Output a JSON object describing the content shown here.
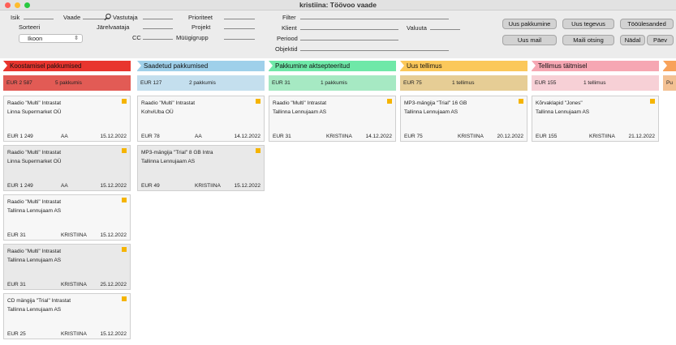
{
  "window": {
    "title": "kristiina: Töövoo vaade"
  },
  "form": {
    "labels": {
      "isik": "Isik",
      "vaade": "Vaade",
      "vastutaja": "Vastutaja",
      "prioriteet": "Prioriteet",
      "sorteeri": "Sorteeri",
      "jarelvaataja": "Järelvaataja",
      "projekt": "Projekt",
      "cc": "CC",
      "muugigrupp": "Müügigrupp",
      "filter": "Filter",
      "klient": "Klient",
      "valuuta": "Valuuta",
      "periood": "Periood",
      "objektid": "Objektid"
    },
    "sort_value": "Ikoon"
  },
  "buttons": {
    "uus_pakkumine": "Uus pakkumine",
    "uus_tegevus": "Uus tegevus",
    "tooulesanded": "Tööülesanded",
    "uus_mail": "Uus mail",
    "maili_otsing": "Maili otsing",
    "nadal": "Nädal",
    "paev": "Päev"
  },
  "columns": [
    {
      "title": "Koostamisel pakkumised",
      "color": "#e8352e",
      "sum_color": "#e25b55",
      "sum": "EUR 2 587",
      "count": "5 pakkumis",
      "cards": [
        {
          "l1": "Raadio \"Multi\" Intrastat",
          "l2": "Linna Supermarket OÜ",
          "amount": "EUR 1 249",
          "user": "AA",
          "date": "15.12.2022"
        },
        {
          "l1": "Raadio \"Multi\" Intrastat",
          "l2": "Linna Supermarket OÜ",
          "amount": "EUR 1 249",
          "user": "AA",
          "date": "15.12.2022"
        },
        {
          "l1": "Raadio \"Multi\" Intrastat",
          "l2": "Tallinna Lennujaam AS",
          "amount": "EUR 31",
          "user": "KRISTIINA",
          "date": "15.12.2022"
        },
        {
          "l1": "Raadio \"Multi\" Intrastat",
          "l2": "Tallinna Lennujaam AS",
          "amount": "EUR 31",
          "user": "KRISTIINA",
          "date": "25.12.2022"
        },
        {
          "l1": "CD mängija \"Trial\" Intrastat",
          "l2": "Tallinna Lennujaam AS",
          "amount": "EUR 25",
          "user": "KRISTIINA",
          "date": "15.12.2022"
        }
      ]
    },
    {
      "title": "Saadetud pakkumised",
      "color": "#9fd0ea",
      "sum_color": "#c4dfee",
      "sum": "EUR 127",
      "count": "2 pakkumis",
      "cards": [
        {
          "l1": "Raadio \"Multi\" Intrastat",
          "l2": "KohviUba OÜ",
          "amount": "EUR 78",
          "user": "AA",
          "date": "14.12.2022"
        },
        {
          "l1": "MP3-mängija \"Trial\" 8 GB Intra",
          "l2": "Tallinna Lennujaam AS",
          "amount": "EUR 49",
          "user": "KRISTIINA",
          "date": "15.12.2022"
        }
      ]
    },
    {
      "title": "Pakkumine aktsepteeritud",
      "color": "#6fe8a8",
      "sum_color": "#a6e9c3",
      "sum": "EUR 31",
      "count": "1 pakkumis",
      "cards": [
        {
          "l1": "Raadio \"Multi\" Intrastat",
          "l2": "Tallinna Lennujaam AS",
          "amount": "EUR 31",
          "user": "KRISTIINA",
          "date": "14.12.2022"
        }
      ]
    },
    {
      "title": "Uus tellimus",
      "color": "#fbc85a",
      "sum_color": "#e6cd95",
      "sum": "EUR 75",
      "count": "1 tellimus",
      "cards": [
        {
          "l1": "MP3-mängija \"Trial\" 16 GB",
          "l2": "Tallinna Lennujaam AS",
          "amount": "EUR 75",
          "user": "KRISTIINA",
          "date": "20.12.2022"
        }
      ]
    },
    {
      "title": "Tellimus täitmisel",
      "color": "#f6a7b3",
      "sum_color": "#f7d0d6",
      "sum": "EUR 155",
      "count": "1 tellimus",
      "cards": [
        {
          "l1": "Kõrvaklapid \"Jones\"",
          "l2": "Tallinna Lennujaam AS",
          "amount": "EUR 155",
          "user": "KRISTIINA",
          "date": "21.12.2022"
        }
      ]
    },
    {
      "title": "",
      "color": "#f8a25a",
      "sum_color": "#f3c193",
      "sum": "Pu",
      "count": "",
      "cards": []
    }
  ]
}
